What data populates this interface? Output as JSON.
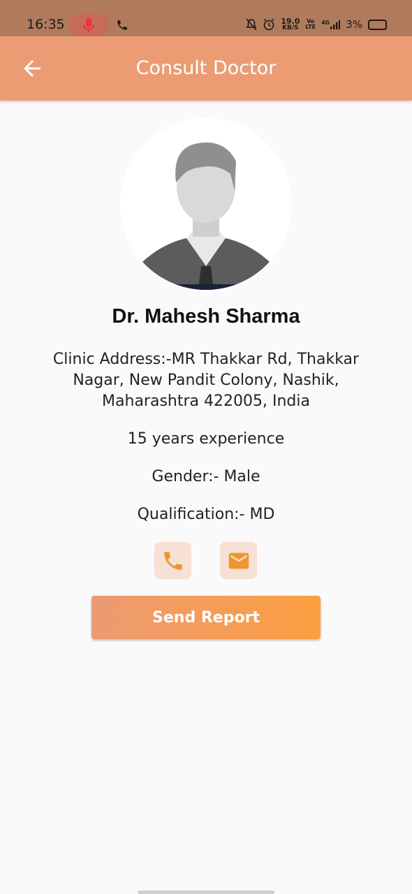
{
  "status_bar": {
    "time": "16:35",
    "speed_value": "19.0",
    "speed_unit": "KB/S",
    "volte_top": "Vo",
    "volte_bottom": "LTE",
    "network": "4G",
    "battery": "3%"
  },
  "app_bar": {
    "title": "Consult Doctor"
  },
  "doctor": {
    "name": "Dr. Mahesh Sharma",
    "address": "Clinic Address:-MR Thakkar Rd, Thakkar Nagar, New Pandit Colony, Nashik, Maharashtra 422005, India",
    "experience": "15 years experience",
    "gender": "Gender:- Male",
    "qualification": "Qualification:- MD"
  },
  "actions": {
    "send_report": "Send Report"
  },
  "colors": {
    "app_bar": "#eb9c73",
    "accent": "#fb9f40",
    "icon": "#f0962f"
  },
  "icons": [
    "back-arrow-icon",
    "phone-icon",
    "mail-icon",
    "mic-icon"
  ]
}
